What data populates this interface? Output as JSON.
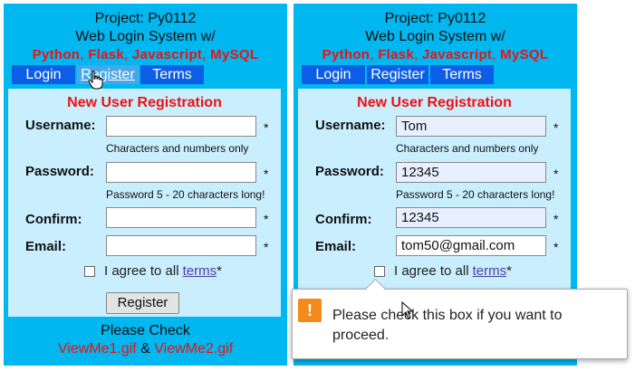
{
  "header": {
    "line1": "Project: Py0112",
    "line2": "Web Login System w/",
    "tech": [
      "Python",
      "Flask",
      "Javascript",
      "MySQL"
    ],
    "tech_sep": ", "
  },
  "tabs": {
    "login": "Login",
    "register": "Register",
    "terms": "Terms"
  },
  "form": {
    "title": "New User Registration",
    "username_label": "Username:",
    "password_label": "Password:",
    "confirm_label": "Confirm:",
    "email_label": "Email:",
    "star": "*",
    "username_hint": "Characters and numbers only",
    "password_hint": "Password 5 - 20 characters long!",
    "agree_text": "I agree to all",
    "terms_link": "terms",
    "agree_star": "*",
    "register_button": "Register"
  },
  "values_left": {
    "username": "",
    "password": "",
    "confirm": "",
    "email": ""
  },
  "values_right": {
    "username": "Tom",
    "password": "12345",
    "confirm": "12345",
    "email": "tom50@gmail.com"
  },
  "footer": {
    "line1": "Please Check",
    "file1": "ViewMe1.gif",
    "amp": " & ",
    "file2": "ViewMe2.gif"
  },
  "tooltip": {
    "icon": "!",
    "message": "Please check this box if you want to proceed."
  },
  "colors": {
    "panel": "#00b7f0",
    "content": "#c9eefe",
    "tab": "#0c5ee6",
    "accent_red": "#ee1111",
    "warning": "#f38a1a"
  }
}
